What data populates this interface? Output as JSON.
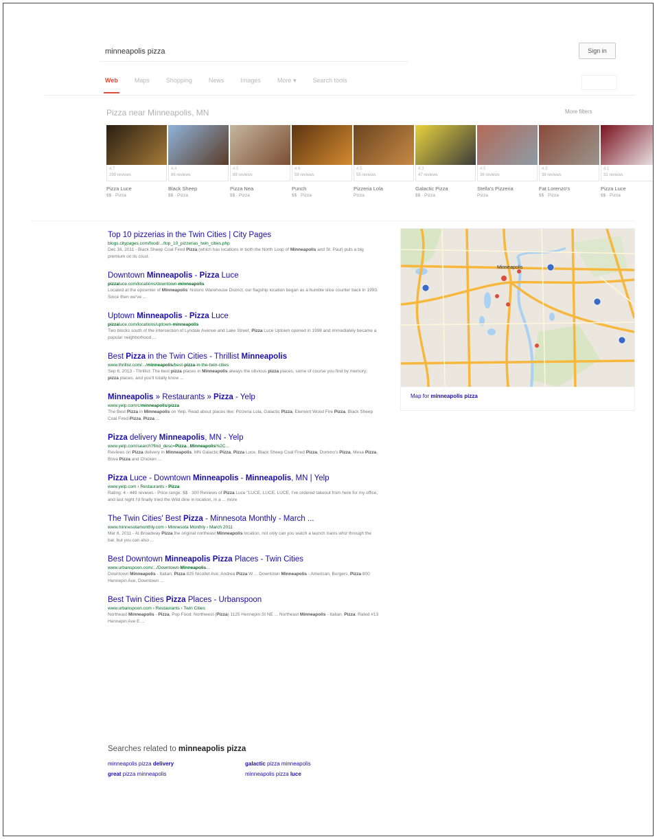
{
  "search": {
    "query": "minneapolis pizza",
    "signin_label": "Sign in"
  },
  "tabs": [
    "Web",
    "Maps",
    "Shopping",
    "News",
    "Images",
    "More",
    "Search tools"
  ],
  "places": {
    "heading": "Pizza near Minneapolis, MN",
    "more_filters": "More filters",
    "cards": [
      {
        "rating": "4.7",
        "reviews": "299 reviews",
        "name": "Pizza Luce",
        "sub": "$$ · Pizza",
        "c1": "#2a1f14",
        "c2": "#a57a37"
      },
      {
        "rating": "4.4",
        "reviews": "86 reviews",
        "name": "Black Sheep",
        "sub": "$$ · Pizza",
        "c1": "#8fb3d9",
        "c2": "#5a3b28"
      },
      {
        "rating": "4.5",
        "reviews": "89 reviews",
        "name": "Pizza Nea",
        "sub": "$$ · Pizza",
        "c1": "#c5b59e",
        "c2": "#7c4f33"
      },
      {
        "rating": "4.6",
        "reviews": "58 reviews",
        "name": "Punch",
        "sub": "$$ · Pizza",
        "c1": "#5c3512",
        "c2": "#d48a2f"
      },
      {
        "rating": "4.5",
        "reviews": "55 reviews",
        "name": "Pizzeria Lola",
        "sub": "Pizza",
        "c1": "#6b4520",
        "c2": "#c78945"
      },
      {
        "rating": "4.3",
        "reviews": "47 reviews",
        "name": "Galactic Pizza",
        "sub": "$$ · Pizza",
        "c1": "#e7d23d",
        "c2": "#3c3c3c"
      },
      {
        "rating": "4.5",
        "reviews": "36 reviews",
        "name": "Stella's Pizzeria",
        "sub": "Pizza",
        "c1": "#b36a57",
        "c2": "#8e9ba7"
      },
      {
        "rating": "4.3",
        "reviews": "38 reviews",
        "name": "Fat Lorenzo's",
        "sub": "$$ · Pizza",
        "c1": "#8b4a3a",
        "c2": "#9b958d"
      },
      {
        "rating": "4.1",
        "reviews": "31 reviews",
        "name": "Pizza Luce",
        "sub": "$$ · Pizza",
        "c1": "#7a1320",
        "c2": "#f1f1f1"
      }
    ]
  },
  "results": [
    {
      "title": "Top 10 pizzerias in the Twin Cities | City Pages",
      "url": "blogs.citypages.com/food/.../top_10_pizzerias_twin_cities.php",
      "snippet": "Dec 16, 2011 - Black Sheep Coal Fired Pizza (which has locations in both the North Loop of Minneapolis and St. Paul) puts a big premium on its crust."
    },
    {
      "title": "Downtown Minneapolis - Pizza Luce",
      "url": "pizzaluce.com/locations/downtown-minneapolis",
      "snippet": "Located at the epicenter of Minneapolis' historic Warehouse District, our flagship location began as a humble slice counter back in 1993. Since then we've ..."
    },
    {
      "title": "Uptown Minneapolis - Pizza Luce",
      "url": "pizzaluce.com/locations/uptown-minneapolis",
      "snippet": "Two blocks south of the intersection of Lyndale Avenue and Lake Street, Pizza Luce Uptown opened in 1998 and immediately became a popular neighborhood ..."
    },
    {
      "title": "Best Pizza in the Twin Cities - Thrillist Minneapolis",
      "url": "www.thrillist.com/.../minneapolis/best-pizza-in-the-twin-cities",
      "snippet": "Sep 6, 2013 - Thrillist: The best pizza places in Minneapolis always the obvious pizza places, some of course you find by memory; pizza places, and you'll totally know ..."
    },
    {
      "title": "Minneapolis » Restaurants » Pizza - Yelp",
      "url": "www.yelp.com/c/minneapolis/pizza",
      "snippet": "The Best Pizza in Minneapolis on Yelp. Read about places like: Pizzeria Lola, Galactic Pizza, Element Wood Fire Pizza, Black Sheep Coal Fired Pizza, Pizza ..."
    },
    {
      "title": "Pizza delivery Minneapolis, MN - Yelp",
      "url": "www.yelp.com/search?find_desc=Pizza...Minneapolis%2C...",
      "snippet": "Reviews on Pizza delivery in Minneapolis, MN Galactic Pizza, Pizza Luce, Black Sheep Coal Fired Pizza, Domino's Pizza, Mesa Pizza, Bova Pizza and Chicken ..."
    },
    {
      "title": "Pizza Luce - Downtown Minneapolis - Minneapolis, MN | Yelp",
      "url": "www.yelp.com › Restaurants › Pizza",
      "snippet": "Rating: 4 - 449 reviews - Price range: $$ · 300 Reviews of Pizza Luce \"LUCE, LUCE, LUCE, I've ordered takeout from here for my office, and last night I'd finally tried the Wild dine in location, in a ... more"
    },
    {
      "title": "The Twin Cities' Best Pizza - Minnesota Monthly - March ...",
      "url": "www.minnesotamonthly.com › Minnesota Monthly › March 2011",
      "snippet": "Mar 6, 2011 - At Broadway Pizza the original northeast Minneapolis location, not only can you watch a launch trains whiz through the bar, but you can also ..."
    },
    {
      "title": "Best Downtown Minneapolis Pizza Places - Twin Cities",
      "url": "www.urbanspoon.com/.../Downtown-Minneapolis...",
      "snippet": "Downtown Minneapolis - Italian, Pizza 825 Nicollet Ave, Andrea Pizza W ... Downtown Minneapolis - American, Burgers, Pizza 800 Hennepin Ave, Downtown ..."
    },
    {
      "title": "Best Twin Cities Pizza Places - Urbanspoon",
      "url": "www.urbanspoon.com › Restaurants › Twin Cities",
      "snippet": "Northeast Minneapolis - Pizza, Pop Food: Northwest (Pizza) 1125 Hennepin St NE ... Northeast Minneapolis - Italian, Pizza: Rated #13 Hennepin Ave E ..."
    }
  ],
  "map": {
    "caption": "Map for minneapolis pizza",
    "center_label": "Minneapolis"
  },
  "related": {
    "heading_prefix": "Searches related to ",
    "heading_query": "minneapolis pizza",
    "items": [
      "minneapolis pizza delivery",
      "galactic pizza minneapolis",
      "great pizza minneapolis",
      "minneapolis pizza luce"
    ]
  },
  "colors": {
    "link": "#1a0dab",
    "url": "#006621",
    "accent": "#dd4b39"
  }
}
